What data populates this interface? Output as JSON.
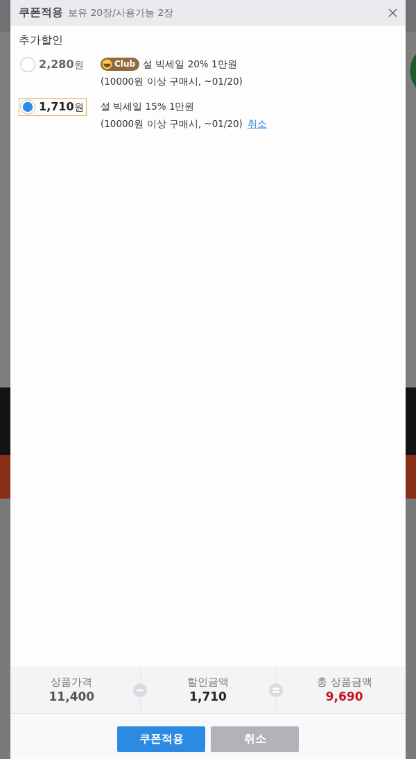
{
  "dialog": {
    "title": "쿠폰적용",
    "subtitle": "보유 20장/사용가능 2장"
  },
  "section_title": "추가할인",
  "coupons": [
    {
      "amount": "**2,280**원",
      "selected": false,
      "badge": "Club",
      "name": "설 빅세일 20% 1만원",
      "condition": "(10000원 이상 구매시, ~01/20)"
    },
    {
      "amount": "**1,710**원",
      "selected": true,
      "name": "설 빅세일 15% 1만원",
      "condition": "(10000원 이상 구매시, ~01/20)",
      "cancel_link": "취소"
    }
  ],
  "summary": [
    {
      "kind": "price",
      "label": "상품가격",
      "value": "11,400"
    },
    {
      "kind": "discount",
      "label": "할인금액",
      "value": "1,710"
    },
    {
      "kind": "total",
      "label": "총 상품금액",
      "value": "9,690"
    }
  ],
  "buttons": [
    {
      "kind": "primary",
      "label": "쿠폰적용"
    },
    {
      "kind": "secondary",
      "label": "취소"
    }
  ]
}
